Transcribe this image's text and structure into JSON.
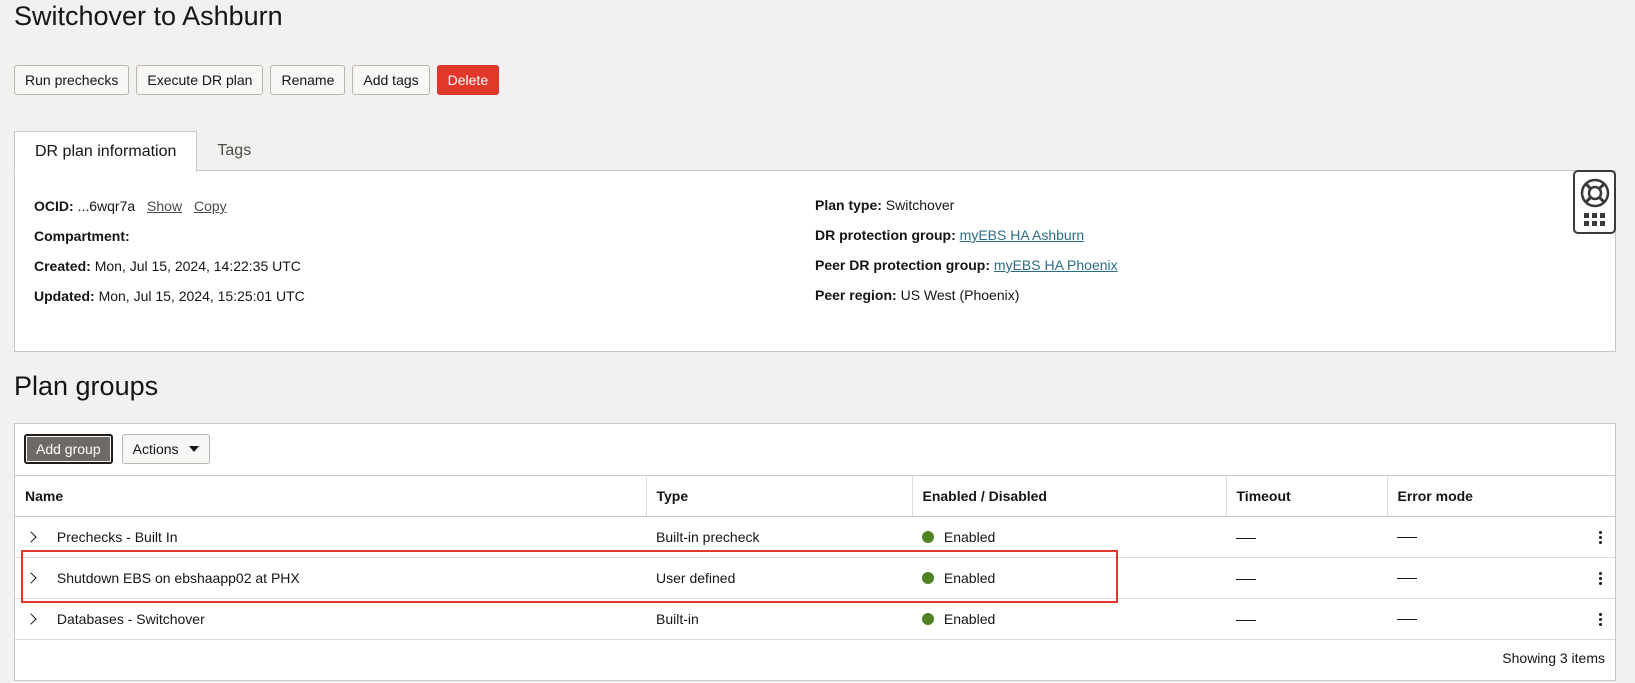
{
  "page_title": "Switchover to Ashburn",
  "toolbar": {
    "run_prechecks": "Run prechecks",
    "execute_dr_plan": "Execute DR plan",
    "rename": "Rename",
    "add_tags": "Add tags",
    "delete": "Delete"
  },
  "tabs": {
    "info": "DR plan information",
    "tags": "Tags"
  },
  "info": {
    "ocid_label": "OCID:",
    "ocid_value": "...6wqr7a",
    "show": "Show",
    "copy": "Copy",
    "compartment_label": "Compartment:",
    "compartment_value": "",
    "created_label": "Created:",
    "created_value": "Mon, Jul 15, 2024, 14:22:35 UTC",
    "updated_label": "Updated:",
    "updated_value": "Mon, Jul 15, 2024, 15:25:01 UTC",
    "plan_type_label": "Plan type:",
    "plan_type_value": "Switchover",
    "dr_group_label": "DR protection group:",
    "dr_group_value": "myEBS HA Ashburn",
    "peer_group_label": "Peer DR protection group:",
    "peer_group_value": "myEBS HA Phoenix",
    "peer_region_label": "Peer region:",
    "peer_region_value": "US West (Phoenix)"
  },
  "plan_groups": {
    "title": "Plan groups",
    "add_group": "Add group",
    "actions": "Actions",
    "columns": [
      "Name",
      "Type",
      "Enabled / Disabled",
      "Timeout",
      "Error mode"
    ],
    "rows": [
      {
        "name": "Prechecks - Built In",
        "type": "Built-in precheck",
        "status": "Enabled"
      },
      {
        "name": "Shutdown EBS on ebshaapp02 at PHX",
        "type": "User defined",
        "status": "Enabled"
      },
      {
        "name": "Databases - Switchover",
        "type": "Built-in",
        "status": "Enabled"
      }
    ],
    "footer": "Showing 3 items"
  },
  "colors": {
    "accent_danger": "#e2372b",
    "status_enabled": "#508223",
    "link": "#2b6d86",
    "highlight_box": "#e2372b"
  }
}
